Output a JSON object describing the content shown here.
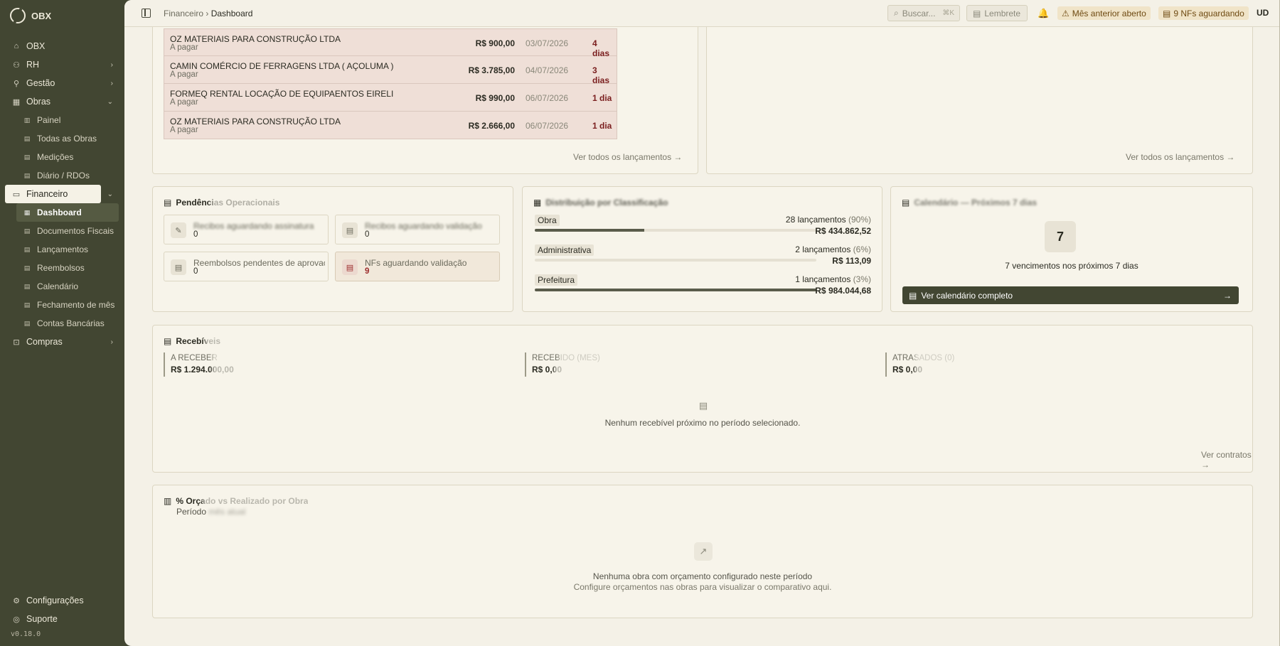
{
  "brand": {
    "name": "OBX"
  },
  "sidebar": {
    "items": [
      {
        "label": "OBX",
        "icon": "home-icon"
      },
      {
        "label": "RH",
        "icon": "users-icon"
      },
      {
        "label": "Gestão",
        "icon": "route-icon"
      },
      {
        "label": "Obras",
        "icon": "building-icon"
      },
      {
        "label": "Painel",
        "icon": "chart-icon"
      },
      {
        "label": "Todas as Obras",
        "icon": "building-icon"
      },
      {
        "label": "Medições",
        "icon": "ruler-icon"
      },
      {
        "label": "Diário / RDOs",
        "icon": "calendar-icon"
      },
      {
        "label": "Financeiro",
        "icon": "wallet-icon"
      },
      {
        "label": "Dashboard",
        "icon": "grid-icon"
      },
      {
        "label": "Documentos Fiscais",
        "icon": "file-icon"
      },
      {
        "label": "Lançamentos",
        "icon": "file-icon"
      },
      {
        "label": "Reembolsos",
        "icon": "receipt-icon"
      },
      {
        "label": "Calendário",
        "icon": "calendar-icon"
      },
      {
        "label": "Fechamento de mês",
        "icon": "calendar-icon"
      },
      {
        "label": "Contas Bancárias",
        "icon": "bank-icon"
      },
      {
        "label": "Compras",
        "icon": "cart-icon"
      }
    ],
    "settings": "Configurações",
    "support": "Suporte",
    "version": "v0.18.0"
  },
  "topbar": {
    "crumb_parent": "Financeiro",
    "crumb_current": "Dashboard",
    "search_placeholder": "Buscar...",
    "search_shortcut": "⌘K",
    "reminder": "Lembrete",
    "badge_month": "Mês anterior aberto",
    "badge_nfs": "9 NFs aguardando",
    "avatar": "UD"
  },
  "payables": {
    "rows": [
      {
        "name": "OZ MATERIAIS PARA CONSTRUÇÃO LTDA",
        "status": "A pagar",
        "value": "R$ 900,00",
        "date": "03/07/2026",
        "days": "4 dias"
      },
      {
        "name": "CAMIN COMÉRCIO DE FERRAGENS LTDA ( AÇOLUMA )",
        "status": "A pagar",
        "value": "R$ 3.785,00",
        "date": "04/07/2026",
        "days": "3 dias"
      },
      {
        "name": "FORMEQ RENTAL LOCAÇÃO DE EQUIPAENTOS EIRELI",
        "status": "A pagar",
        "value": "R$ 990,00",
        "date": "06/07/2026",
        "days": "1 dia"
      },
      {
        "name": "OZ MATERIAIS PARA CONSTRUÇÃO LTDA",
        "status": "A pagar",
        "value": "R$ 2.666,00",
        "date": "06/07/2026",
        "days": "1 dia"
      }
    ],
    "link": "Ver todos os lançamentos"
  },
  "right_top": {
    "link": "Ver todos os lançamentos"
  },
  "pendencias": {
    "title": "Pendências Operacionais",
    "items": [
      {
        "label": "Recibos aguardando assinatura",
        "value": "0",
        "icon": "pen-icon"
      },
      {
        "label": "Recibos aguardando validação",
        "value": "0",
        "icon": "receipt-icon"
      },
      {
        "label": "Reembolsos pendentes de aprovação",
        "value": "0",
        "icon": "file-icon"
      },
      {
        "label": "NFs aguardando validação",
        "value": "9",
        "icon": "file-alert-icon"
      }
    ]
  },
  "distribution": {
    "title": "Distribuição por Classificação",
    "rows": [
      {
        "label": "Obra",
        "count": "28 lançamentos",
        "pct": "(90%)",
        "amount": "R$ 434.862,52",
        "fill": 0.39
      },
      {
        "label": "Administrativa",
        "count": "2 lançamentos",
        "pct": "(6%)",
        "amount": "R$ 113,09",
        "fill": 0.0
      },
      {
        "label": "Prefeitura",
        "count": "1 lançamentos",
        "pct": "(3%)",
        "amount": "R$ 984.044,68",
        "fill": 1.0
      }
    ]
  },
  "calendar": {
    "title": "Calendário — Próximos 7 dias",
    "number": "7",
    "text": "7 vencimentos nos próximos 7 dias",
    "button": "Ver calendário completo"
  },
  "receivables": {
    "title": "Recebíveis",
    "cols": [
      {
        "label": "A RECEBER",
        "value": "R$ 1.294.000,00"
      },
      {
        "label": "RECEBIDO (MÊS)",
        "value": "R$ 0,00"
      },
      {
        "label": "ATRASADOS (0)",
        "value": "R$ 0,00"
      }
    ],
    "empty": "Nenhum recebível próximo no período selecionado.",
    "link": "Ver contratos"
  },
  "budget": {
    "title": "% Orçado vs Realizado por Obra",
    "period_label": "Período",
    "period_value": "mês atual",
    "empty": "Nenhuma obra com orçamento configurado neste período",
    "empty_sub": "Configure orçamentos nas obras para visualizar o comparativo aqui."
  }
}
